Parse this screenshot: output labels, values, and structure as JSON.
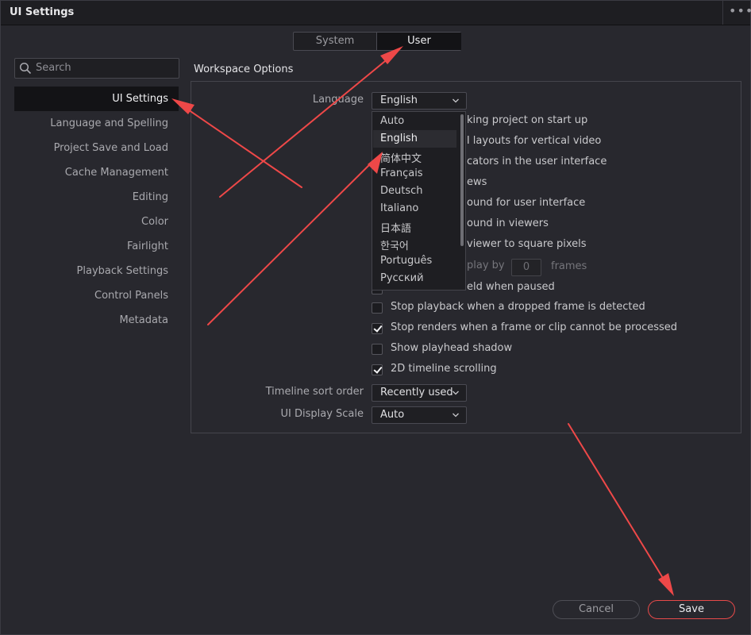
{
  "window": {
    "title": "UI Settings",
    "more_glyph": "•••"
  },
  "tabs": {
    "system": "System",
    "user": "User"
  },
  "search": {
    "placeholder": "Search"
  },
  "nav": [
    "UI Settings",
    "Language and Spelling",
    "Project Save and Load",
    "Cache Management",
    "Editing",
    "Color",
    "Fairlight",
    "Playback Settings",
    "Control Panels",
    "Metadata"
  ],
  "section_title": "Workspace Options",
  "language": {
    "label": "Language",
    "value": "English",
    "options": [
      "Auto",
      "English",
      "简体中文",
      "Français",
      "Deutsch",
      "Italiano",
      "日本語",
      "한국어",
      "Português",
      "Русский"
    ]
  },
  "partial_rows": [
    "king project on start up",
    "JI layouts for vertical video",
    "cators in the user interface",
    "ews",
    "ound for user interface",
    "ound in viewers",
    "viewer to square pixels",
    "play by",
    "eld when paused"
  ],
  "frames": {
    "value": "0",
    "unit": "frames"
  },
  "checkboxes": [
    {
      "label": "Stop playback when a dropped frame is detected",
      "checked": false
    },
    {
      "label": "Stop renders when a frame or clip cannot be processed",
      "checked": true
    },
    {
      "label": "Show playhead shadow",
      "checked": false
    },
    {
      "label": "2D timeline scrolling",
      "checked": true
    }
  ],
  "timeline_sort": {
    "label": "Timeline sort order",
    "value": "Recently used"
  },
  "ui_scale": {
    "label": "UI Display Scale",
    "value": "Auto"
  },
  "buttons": {
    "cancel": "Cancel",
    "save": "Save"
  },
  "colors": {
    "annotation_red": "#ee4848",
    "save_border": "#e84a4a",
    "background": "#28282e"
  }
}
